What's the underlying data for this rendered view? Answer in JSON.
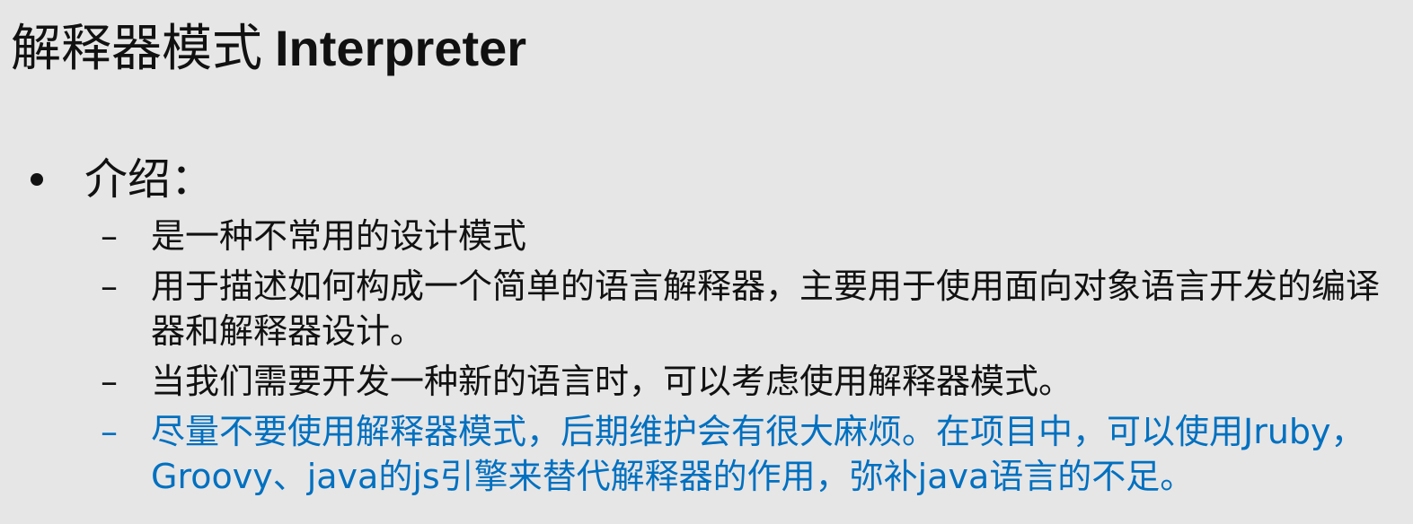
{
  "slide": {
    "title_cn": "解释器模式",
    "title_en": "Interpreter",
    "bullet": "介绍：",
    "dash": "–",
    "items": [
      {
        "text": "是一种不常用的设计模式"
      },
      {
        "text": "用于描述如何构成一个简单的语言解释器，主要用于使用面向对象语言开发的编译器和解释器设计。"
      },
      {
        "text": "当我们需要开发一种新的语言时，可以考虑使用解释器模式。"
      },
      {
        "text": "尽量不要使用解释器模式，后期维护会有很大麻烦。在项目中，可以使用Jruby，Groovy、java的js引擎来替代解释器的作用，弥补java语言的不足。"
      }
    ],
    "highlight_color": "#0070c0",
    "text_color": "#111111",
    "background_color": "#e6e6e6"
  }
}
